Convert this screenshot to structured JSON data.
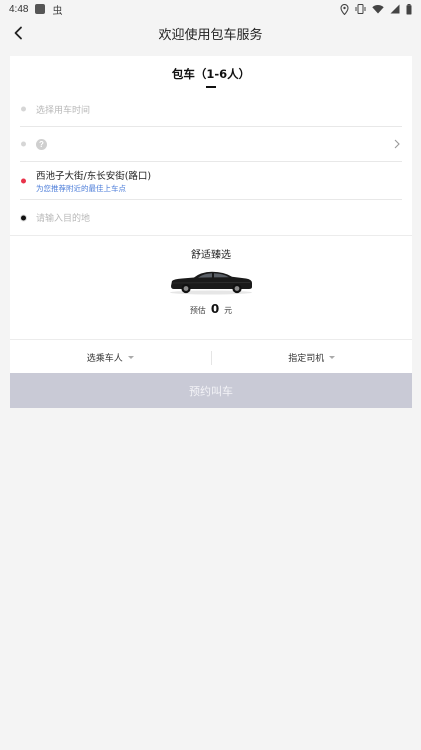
{
  "status_bar": {
    "time": "4:48",
    "icons": [
      "app-square-icon",
      "bug-icon",
      "location-icon",
      "vibrate-icon",
      "wifi-icon",
      "signal-icon",
      "battery-icon"
    ],
    "bug_glyph": "虫"
  },
  "header": {
    "title": "欢迎使用包车服务",
    "back_icon": "chevron-left-icon"
  },
  "tab": {
    "label": "包车（1-6人）"
  },
  "form": {
    "time_placeholder": "选择用车时间",
    "help_glyph": "?",
    "pickup_address": "西池子大街/东长安街(路口)",
    "pickup_hint": "为您推荐附近的最佳上车点",
    "destination_placeholder": "请输入目的地"
  },
  "car": {
    "name": "舒适臻选",
    "price_label": "预估",
    "price_value": "0",
    "price_unit": "元"
  },
  "options": {
    "passenger_label": "选乘车人",
    "driver_label": "指定司机"
  },
  "book_button": {
    "label": "预约叫车"
  },
  "colors": {
    "pickup_dot": "#e8334a",
    "hint_text": "#4a7bd8",
    "book_button_bg": "#c9cad6",
    "page_bg": "#f4f4f4"
  }
}
